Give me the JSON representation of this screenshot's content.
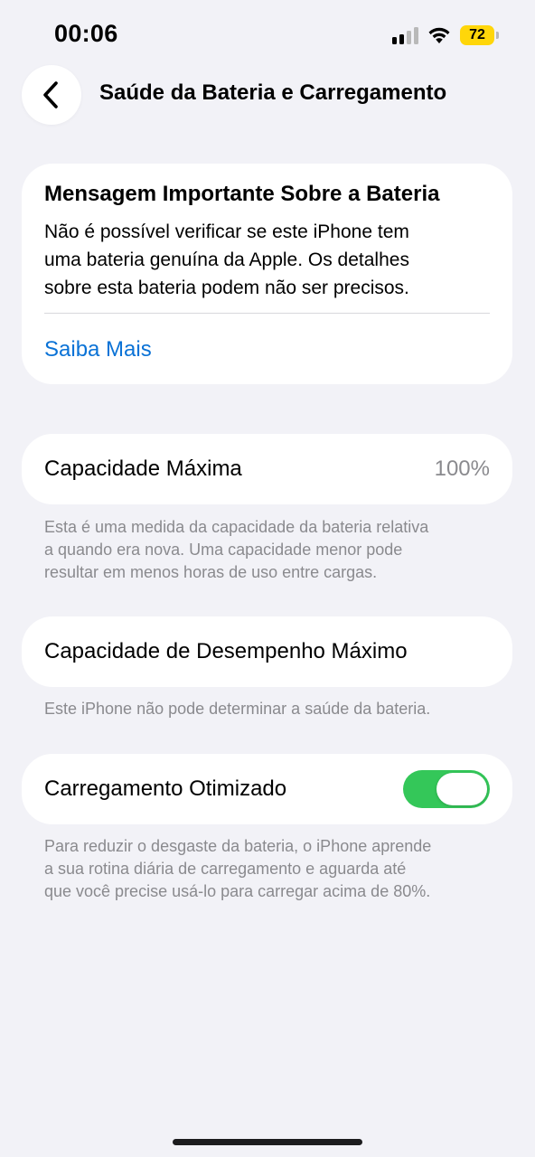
{
  "status_bar": {
    "time": "00:06",
    "battery_level": "72",
    "battery_color": "#ffd60a",
    "signal_bars_active": 2,
    "signal_bars_total": 4,
    "icons": [
      "signal-icon",
      "wifi-icon",
      "battery-icon"
    ]
  },
  "nav": {
    "back_icon": "chevron-left-icon",
    "title": "Saúde da Bateria e Carregamento"
  },
  "important_message": {
    "title": "Mensagem Importante Sobre a Bateria",
    "body_lines": [
      "Não é possível verificar se este iPhone tem",
      "uma bateria genuína da Apple. Os detalhes",
      "sobre esta bateria podem não ser precisos."
    ],
    "link_label": "Saiba Mais",
    "link_color": "#0a72d6"
  },
  "max_capacity": {
    "label": "Capacidade Máxima",
    "value": "100%",
    "footnote_lines": [
      "Esta é uma medida da capacidade da bateria relativa",
      "a quando era nova. Uma capacidade menor pode",
      "resultar em menos horas de uso entre cargas."
    ]
  },
  "peak_performance": {
    "label": "Capacidade de Desempenho Máximo",
    "footnote": "Este iPhone não pode determinar a saúde da bateria."
  },
  "optimized_charging": {
    "label": "Carregamento Otimizado",
    "enabled": true,
    "toggle_color": "#34c759",
    "footnote_lines": [
      "Para reduzir o desgaste da bateria, o iPhone aprende",
      "a sua rotina diária de carregamento e aguarda até",
      "que você precise usá-lo para carregar acima de 80%."
    ]
  }
}
